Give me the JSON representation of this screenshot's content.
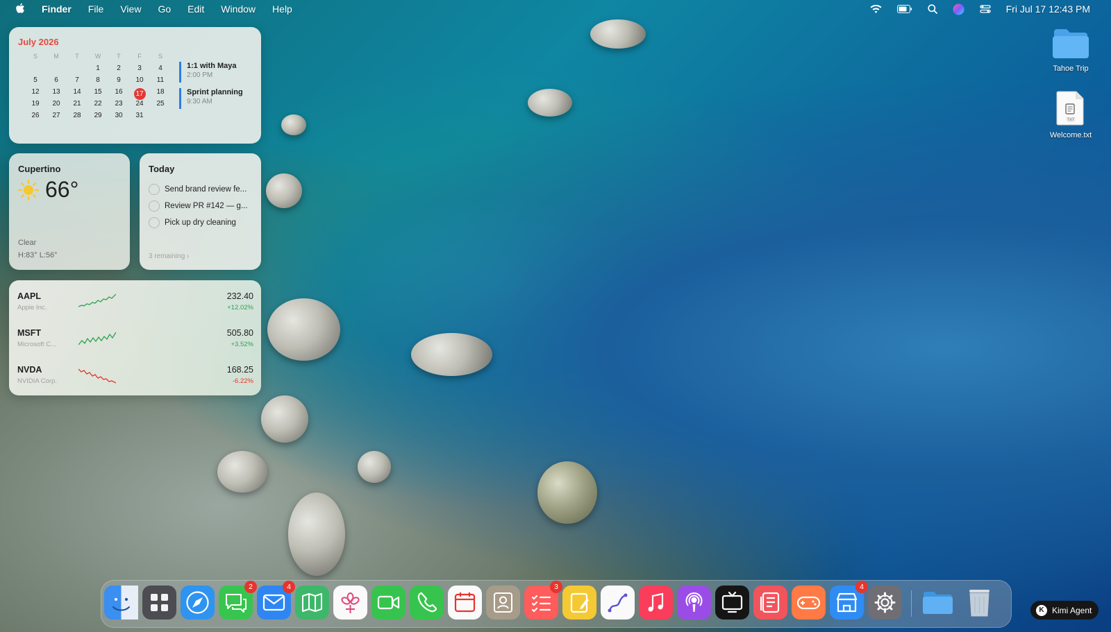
{
  "menubar": {
    "app_name": "Finder",
    "menus": [
      "File",
      "View",
      "Go",
      "Edit",
      "Window",
      "Help"
    ],
    "clock": "Fri Jul 17  12:43 PM",
    "status_icons": [
      "wifi-icon",
      "battery-icon",
      "search-icon",
      "siri-icon",
      "control-center-icon"
    ]
  },
  "calendar": {
    "month_title": "July 2026",
    "weekdays": [
      "S",
      "M",
      "T",
      "W",
      "T",
      "F",
      "S"
    ],
    "days": [
      "",
      "",
      "",
      "1",
      "2",
      "3",
      "4",
      "5",
      "6",
      "7",
      "8",
      "9",
      "10",
      "11",
      "12",
      "13",
      "14",
      "15",
      "16",
      "17",
      "18",
      "19",
      "20",
      "21",
      "22",
      "23",
      "24",
      "25",
      "26",
      "27",
      "28",
      "29",
      "30",
      "31"
    ],
    "today": "17",
    "events": [
      {
        "title": "1:1 with Maya",
        "time": "2:00 PM"
      },
      {
        "title": "Sprint planning",
        "time": "9:30 AM"
      }
    ]
  },
  "weather": {
    "city": "Cupertino",
    "temp": "66°",
    "condition": "Clear",
    "high_low": "H:83° L:56°"
  },
  "reminders": {
    "title": "Today",
    "items": [
      "Send brand review fe...",
      "Review PR #142 — g...",
      "Pick up dry cleaning"
    ],
    "footer": "3 remaining  ›"
  },
  "stocks": [
    {
      "symbol": "AAPL",
      "name": "Apple Inc.",
      "price": "232.40",
      "change": "+12.02%",
      "trend": "up"
    },
    {
      "symbol": "MSFT",
      "name": "Microsoft C...",
      "price": "505.80",
      "change": "+3.52%",
      "trend": "up"
    },
    {
      "symbol": "NVDA",
      "name": "NVIDIA Corp.",
      "price": "168.25",
      "change": "-6.22%",
      "trend": "down"
    }
  ],
  "desktop": {
    "folder": "Tahoe Trip",
    "file": "Welcome.txt",
    "file_type": "TXT"
  },
  "colors": {
    "accent_red": "#e23a35",
    "event_blue": "#2b7de9",
    "stock_up": "#2aa44f",
    "stock_down": "#e5352e"
  },
  "dock": {
    "apps": [
      {
        "name": "Finder",
        "icon": "finder-icon"
      },
      {
        "name": "Launchpad",
        "icon": "launchpad-icon"
      },
      {
        "name": "Safari",
        "icon": "safari-icon"
      },
      {
        "name": "Messages",
        "icon": "messages-icon",
        "badge": "2"
      },
      {
        "name": "Mail",
        "icon": "mail-icon",
        "badge": "4"
      },
      {
        "name": "Maps",
        "icon": "maps-icon"
      },
      {
        "name": "Photos",
        "icon": "photos-icon"
      },
      {
        "name": "FaceTime",
        "icon": "facetime-icon"
      },
      {
        "name": "Phone",
        "icon": "phone-icon"
      },
      {
        "name": "Calendar",
        "icon": "calendar-icon"
      },
      {
        "name": "Contacts",
        "icon": "contacts-icon"
      },
      {
        "name": "Reminders",
        "icon": "reminders-icon",
        "badge": "3"
      },
      {
        "name": "Notes",
        "icon": "notes-icon"
      },
      {
        "name": "Freeform",
        "icon": "freeform-icon"
      },
      {
        "name": "Music",
        "icon": "music-icon"
      },
      {
        "name": "Podcasts",
        "icon": "podcasts-icon"
      },
      {
        "name": "TV",
        "icon": "tv-icon"
      },
      {
        "name": "News",
        "icon": "news-icon"
      },
      {
        "name": "Arcade",
        "icon": "arcade-icon"
      },
      {
        "name": "App Store",
        "icon": "app-store-icon",
        "badge": "4"
      },
      {
        "name": "System Settings",
        "icon": "settings-icon"
      }
    ],
    "folder": "Downloads",
    "trash": "Trash"
  },
  "agent": {
    "mark": "K",
    "label": "Kimi Agent"
  }
}
